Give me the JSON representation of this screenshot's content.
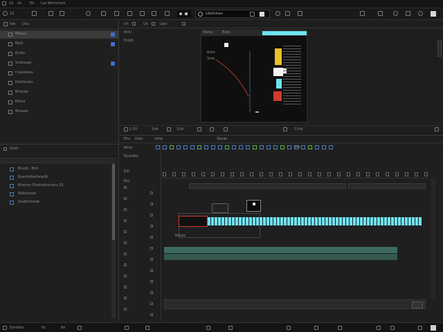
{
  "menubar": {
    "items": [
      "1S",
      "vb",
      "Eb",
      "Las Wmnmsth"
    ],
    "center_label": "Ubhlhlnes"
  },
  "left_panel": {
    "header": [
      "Ilds",
      "Ulss"
    ],
    "items": [
      {
        "label": "Blbass",
        "selected": true
      },
      {
        "label": "Ebtd",
        "selected": false
      },
      {
        "label": "Esobc",
        "selected": false
      },
      {
        "label": "Vnbtssad",
        "selected": false
      },
      {
        "label": "Cnadstess",
        "selected": false
      },
      {
        "label": "Drbrbnatu",
        "selected": false
      },
      {
        "label": "Brtlsloa",
        "selected": false
      },
      {
        "label": "Eltsss",
        "selected": false
      },
      {
        "label": "Bkseeb",
        "selected": false
      }
    ],
    "section2_label": "Dllsh",
    "media_items": [
      "Bnstd - Brst",
      "Byavlstbarhvsolb",
      "Bharms Dhotsslhvnlers 2S",
      "Sblbcoovb",
      "Drablrhnsob"
    ]
  },
  "viewer": {
    "side_labels": [
      "Ehhl",
      "Enblh"
    ],
    "tabs": [
      "Uh",
      "Uh",
      "Lbsl"
    ],
    "inner_tabs": [
      "Esrsn",
      "Bsrb"
    ],
    "overlay_labels": [
      "Brbv",
      "Stsb"
    ],
    "timecode_left": "1:20",
    "timecode_right": "11nb",
    "controls": [
      "1nb",
      "1Ub"
    ]
  },
  "timeline": {
    "header_tabs": [
      "Ehs",
      "Dats",
      "Vshb",
      "Sbnsb"
    ],
    "track_labels": [
      "Bhhs",
      "Exosdbs",
      "Edl",
      "Bss"
    ],
    "clip_label": "Nhsbs",
    "sub_label": "Brb",
    "colors": {
      "cyan": "#6fe3f2",
      "green": "#3d6b62",
      "red": "#d23a2a",
      "yellow": "#e8c22a"
    }
  },
  "statusbar": {
    "items": [
      "Eshobhs",
      "Es",
      "Ns"
    ]
  }
}
